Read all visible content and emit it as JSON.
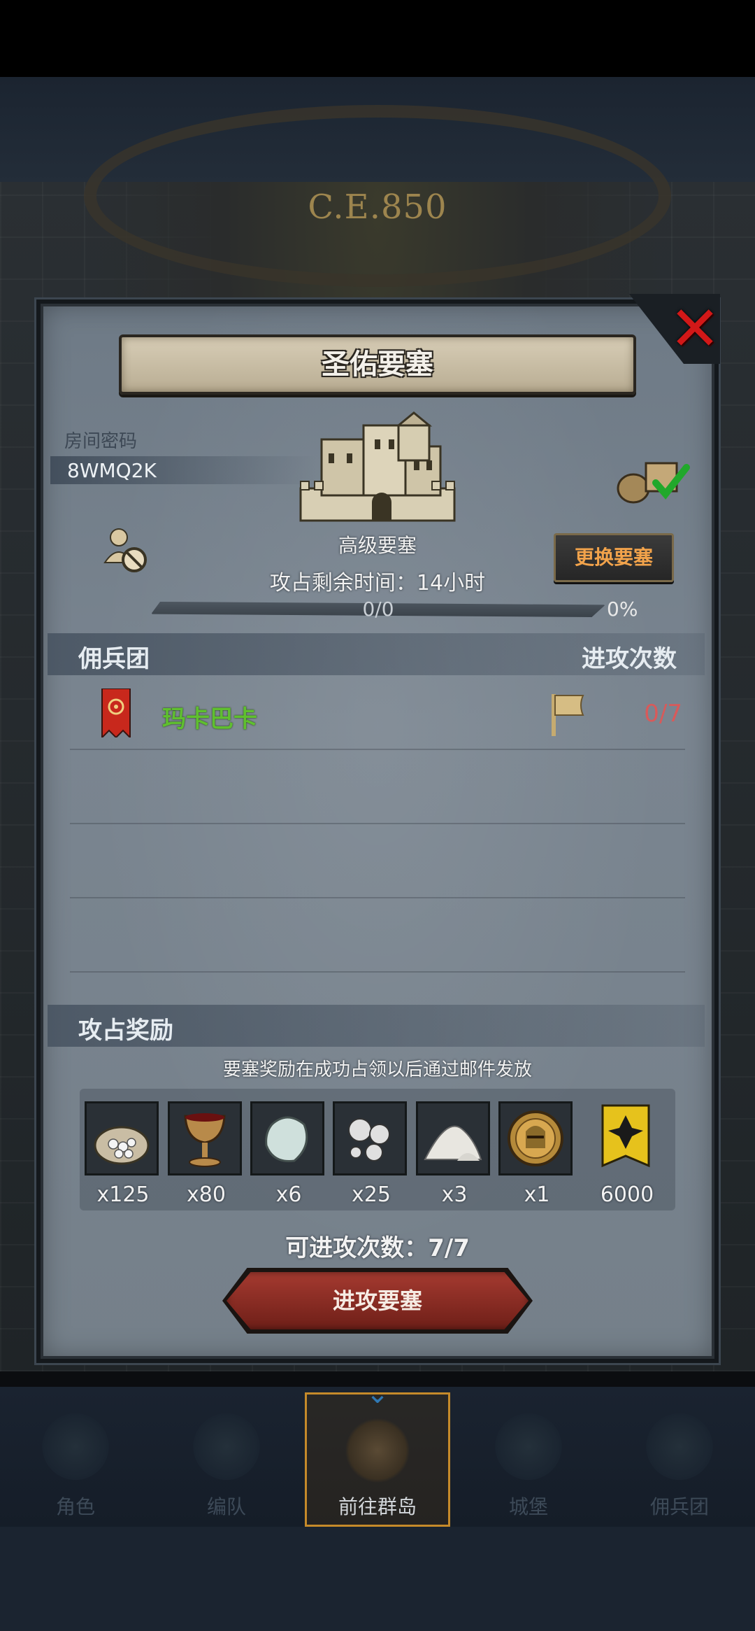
{
  "background": {
    "era_label": "C.E.850"
  },
  "dialog": {
    "title": "圣佑要塞",
    "room": {
      "label": "房间密码",
      "code": "8WMQ2K"
    },
    "fortress_level": "高级要塞",
    "change_button": "更换要塞",
    "time_remaining": "攻占剩余时间：14小时",
    "progress": {
      "text": "0/0",
      "percent": "0%",
      "fraction": 0
    },
    "mercenaries": {
      "header_left": "佣兵团",
      "header_right": "进攻次数",
      "rows": [
        {
          "name": "玛卡巴卡",
          "attacks": "0/7"
        }
      ]
    },
    "rewards": {
      "header": "攻占奖励",
      "note": "要塞奖励在成功占领以后通过邮件发放",
      "items": [
        {
          "icon": "silver-ore-sack-icon",
          "count": "x125"
        },
        {
          "icon": "goblet-icon",
          "count": "x80"
        },
        {
          "icon": "moonstone-icon",
          "count": "x6"
        },
        {
          "icon": "silver-pearls-icon",
          "count": "x25"
        },
        {
          "icon": "salt-pile-icon",
          "count": "x3"
        },
        {
          "icon": "knight-medal-icon",
          "count": "x1"
        },
        {
          "icon": "gold-banner-icon",
          "count": "6000"
        }
      ]
    },
    "attempts_text": "可进攻次数：7/7",
    "attack_button": "进攻要塞"
  },
  "nav": [
    {
      "label": "角色",
      "icon": "knight-icon",
      "active": false
    },
    {
      "label": "编队",
      "icon": "formation-icon",
      "active": false
    },
    {
      "label": "前往群岛",
      "icon": "compass-icon",
      "active": true
    },
    {
      "label": "城堡",
      "icon": "castle-icon",
      "active": false
    },
    {
      "label": "佣兵团",
      "icon": "mercenary-icon",
      "active": false
    }
  ],
  "colors": {
    "accent_orange": "#f2a34b",
    "merc_green": "#5fbf2f",
    "count_red": "#d85a5a",
    "close_red": "#d21818"
  }
}
